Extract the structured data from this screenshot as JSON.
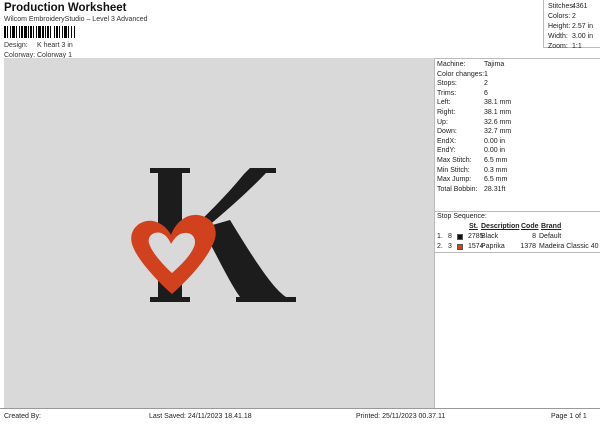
{
  "header": {
    "title": "Production Worksheet",
    "subtitle": "Wilcom EmbroideryStudio – Level 3 Advanced",
    "design_label": "Design:",
    "design_value": "K heart 3 in",
    "colorway_label": "Colorway:",
    "colorway_value": "Colorway 1"
  },
  "stats": [
    {
      "label": "Stitches:",
      "value": "4361"
    },
    {
      "label": "Colors:",
      "value": "2"
    },
    {
      "label": "Height:",
      "value": "2.57 in"
    },
    {
      "label": "Width:",
      "value": "3.00 in"
    },
    {
      "label": "Zoom:",
      "value": "1:1"
    }
  ],
  "machine_info": [
    {
      "label": "Machine:",
      "value": "Tajima"
    },
    {
      "label": "Color changes:",
      "value": "1"
    },
    {
      "label": "Stops:",
      "value": "2"
    },
    {
      "label": "Trims:",
      "value": "6"
    },
    {
      "label": "Left:",
      "value": "38.1 mm"
    },
    {
      "label": "Right:",
      "value": "38.1 mm"
    },
    {
      "label": "Up:",
      "value": "32.6 mm"
    },
    {
      "label": "Down:",
      "value": "32.7 mm"
    },
    {
      "label": "EndX:",
      "value": "0.00 in"
    },
    {
      "label": "EndY:",
      "value": "0.00 in"
    },
    {
      "label": "Max Stitch:",
      "value": "6.5 mm"
    },
    {
      "label": "Min Stitch:",
      "value": "0.3 mm"
    },
    {
      "label": "Max Jump:",
      "value": "6.5 mm"
    },
    {
      "label": "Total Bobbin:",
      "value": "28.31ft"
    }
  ],
  "stop_sequence": {
    "title": "Stop Sequence:",
    "headers": {
      "st": "St.",
      "description": "Description",
      "code": "Code",
      "brand": "Brand"
    },
    "rows": [
      {
        "index": "1.",
        "stop": "8",
        "st": "2785",
        "description": "Black",
        "code": "8",
        "brand": "Default",
        "color": "#111111"
      },
      {
        "index": "2.",
        "stop": "3",
        "st": "1574",
        "description": "Paprika",
        "code": "1378",
        "brand": "Madeira Classic 40",
        "color": "#d2411e"
      }
    ]
  },
  "footer": {
    "created_by": "Created By:",
    "last_saved": "Last Saved: 24/11/2023 18.41.18",
    "printed": "Printed: 25/11/2023 00.37.11",
    "page": "Page 1 of 1"
  },
  "colors": {
    "background": "#d9d9d9",
    "letter": "#1c1c1c",
    "heart": "#d2411e"
  },
  "preview_icon": "k-with-heart-embroidery"
}
